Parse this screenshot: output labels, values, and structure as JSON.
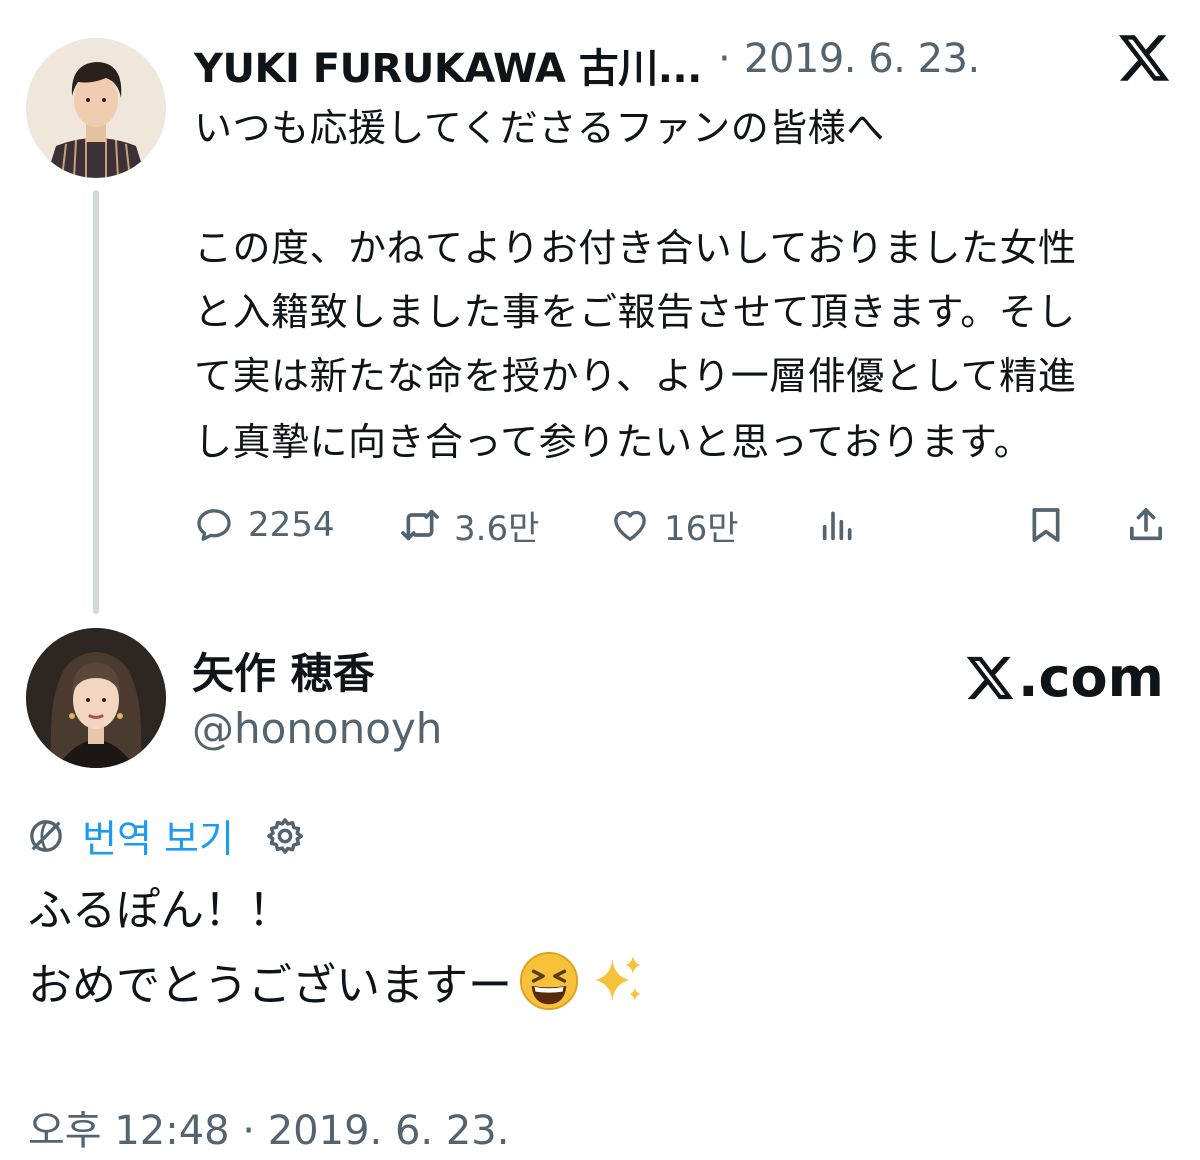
{
  "quoted_tweet": {
    "author_name": "YUKI FURUKAWA 古川...",
    "separator": "·",
    "date": "2019. 6. 23.",
    "lines": [
      "いつも応援してくださるファンの皆様へ",
      "",
      "この度、かねてよりお付き合いしておりました女性",
      "と入籍致しました事をご報告させて頂きます。そし",
      "て実は新たな命を授かり、より一層俳優として精進",
      "し真摯に向き合って参りたいと思っております。"
    ],
    "actions": {
      "replies": "2254",
      "retweets": "3.6만",
      "likes": "16만"
    },
    "icons": [
      "reply-icon",
      "retweet-icon",
      "like-icon",
      "views-icon",
      "bookmark-icon",
      "share-icon"
    ]
  },
  "reply_tweet": {
    "author_name": "矢作 穂香",
    "handle": "@hononoyh",
    "brand": ".com",
    "translate_label": "번역 보기",
    "lines": [
      "ふるぽん！！",
      "おめでとうございますー"
    ],
    "emojis": [
      "grinning-squinting-face",
      "sparkles"
    ],
    "timestamp": "오후 12:48 · 2019. 6. 23."
  },
  "colors": {
    "text": "#0f1419",
    "secondary": "#536471",
    "link": "#1d9bf0",
    "thread_line": "#cfd9de"
  }
}
